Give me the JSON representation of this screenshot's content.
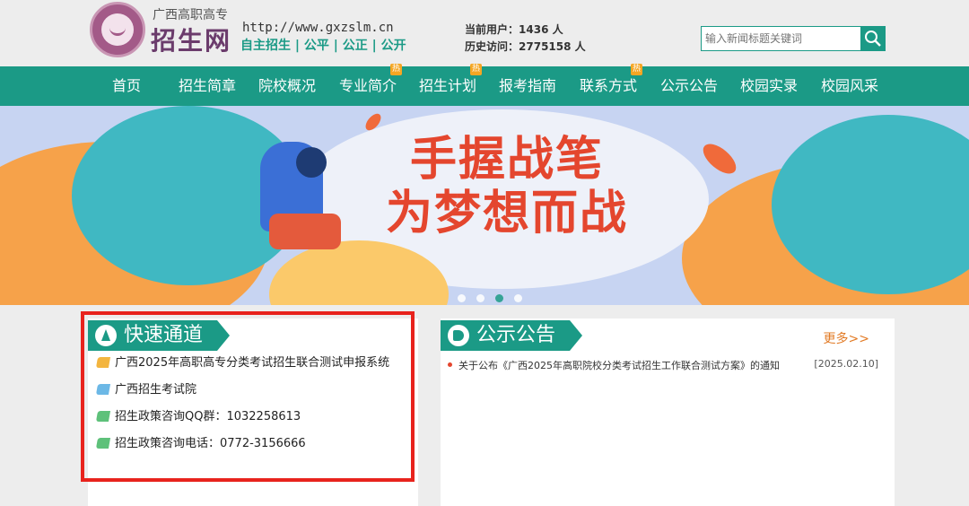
{
  "header": {
    "logo_sub": "广西高职高专",
    "logo_main": "招生网",
    "url": "http://www.gxzslm.cn",
    "slogan": "自主招生 | 公平 | 公正 | 公开",
    "current_users_label": "当前用户：",
    "current_users_value": "1436 人",
    "history_visits_label": "历史访问：",
    "history_visits_value": "2775158 人",
    "search_placeholder": "输入新闻标题关键词"
  },
  "nav": {
    "items": [
      {
        "label": "首页",
        "hot": ""
      },
      {
        "label": "招生简章",
        "hot": ""
      },
      {
        "label": "院校概况",
        "hot": ""
      },
      {
        "label": "专业简介",
        "hot": "热"
      },
      {
        "label": "招生计划",
        "hot": "热"
      },
      {
        "label": "报考指南",
        "hot": ""
      },
      {
        "label": "联系方式",
        "hot": "热"
      },
      {
        "label": "公示公告",
        "hot": ""
      },
      {
        "label": "校园实录",
        "hot": ""
      },
      {
        "label": "校园风采",
        "hot": ""
      }
    ]
  },
  "banner": {
    "line1": "手握战笔",
    "line2": "为梦想而战"
  },
  "quick": {
    "title": "快速通道",
    "links": [
      {
        "label": "广西2025年高职高专分类考试招生联合测试申报系统",
        "color": "#f3b53f"
      },
      {
        "label": "广西招生考试院",
        "color": "#6cb8e6"
      },
      {
        "label": "招生政策咨询QQ群：1032258613",
        "color": "#5ec17a"
      },
      {
        "label": "招生政策咨询电话：0772-3156666",
        "color": "#5ec17a"
      }
    ]
  },
  "notice": {
    "title": "公示公告",
    "more": "更多>>",
    "items": [
      {
        "text": "关于公布《广西2025年高职院校分类考试招生工作联合测试方案》的通知",
        "date": "[2025.02.10]"
      }
    ]
  },
  "colors": {
    "brand": "#1b9a86",
    "highlight": "#e8231d",
    "banner_title": "#e4462e"
  }
}
